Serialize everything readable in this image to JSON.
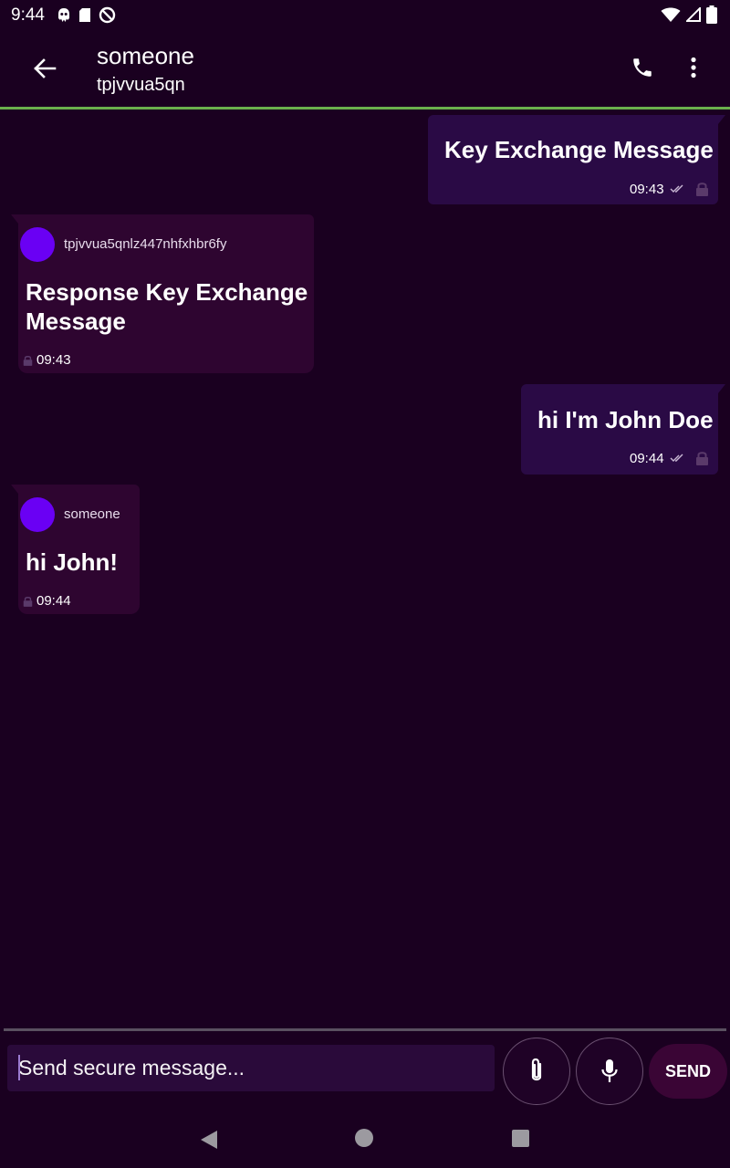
{
  "status_bar": {
    "time": "9:44",
    "left_icons": [
      "ghost-icon",
      "sd-card-icon",
      "no-disturb-icon"
    ],
    "right_icons": [
      "wifi-icon",
      "signal-icon",
      "battery-icon"
    ]
  },
  "header": {
    "contact_name": "someone",
    "contact_id": "tpjvvua5qn",
    "accent_color": "#6ab04c"
  },
  "messages": [
    {
      "direction": "outgoing",
      "text": "Key Exchange Message",
      "time": "09:43",
      "status": "delivered",
      "encrypted": true
    },
    {
      "direction": "incoming",
      "sender": "tpjvvua5qnlz447nhfxhbr6fy",
      "text_line1": "Response Key Exchange",
      "text_line2": "Message",
      "time": "09:43",
      "encrypted": true
    },
    {
      "direction": "outgoing",
      "text": "hi I'm John Doe",
      "time": "09:44",
      "status": "delivered",
      "encrypted": true
    },
    {
      "direction": "incoming",
      "sender": "someone",
      "text": "hi John!",
      "time": "09:44",
      "encrypted": true
    }
  ],
  "composer": {
    "placeholder": "Send secure message...",
    "send_label": "SEND"
  },
  "colors": {
    "background": "#1a0020",
    "outgoing_bubble": "#2a0a45",
    "incoming_bubble": "#2e0530",
    "avatar": "#6a00f4"
  }
}
